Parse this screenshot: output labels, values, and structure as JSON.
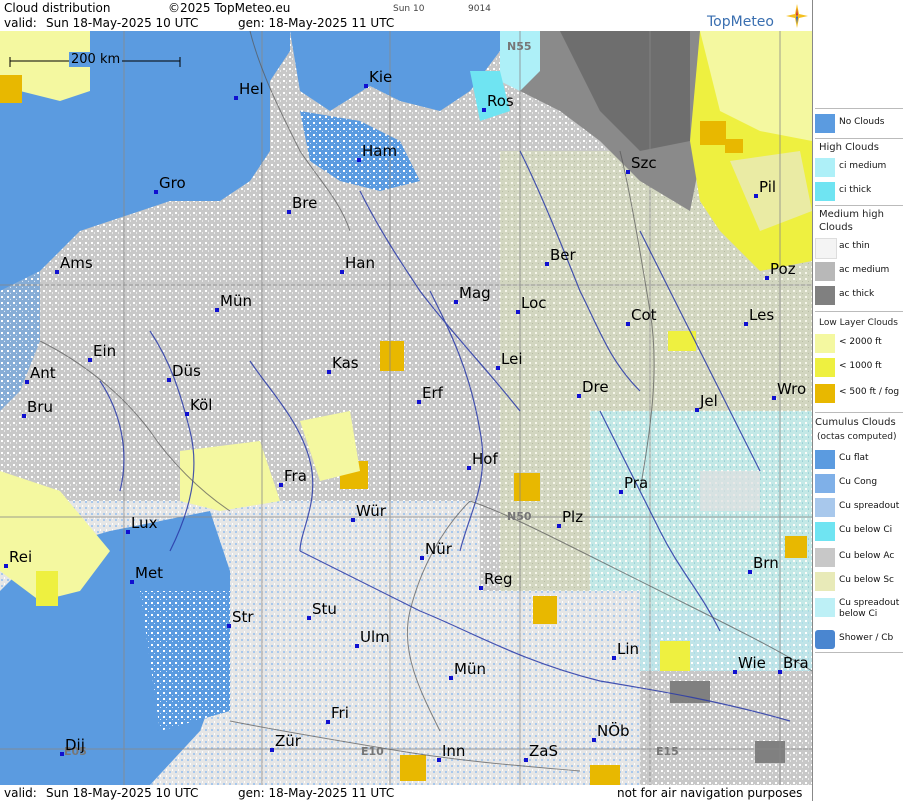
{
  "header": {
    "title": "Cloud distribution",
    "copyright": "©2025 TopMeteo.eu",
    "run_label": "Sun 10",
    "code": "9014",
    "valid_label": "valid:",
    "valid_value": "Sun  18-May-2025  10 UTC",
    "gen_value": "gen: 18-May-2025 11 UTC",
    "logo": "TopMeteo"
  },
  "footer": {
    "valid_label": "valid:",
    "valid_value": "Sun  18-May-2025  10 UTC",
    "gen_value": "gen: 18-May-2025 11 UTC",
    "disclaimer": "not for air navigation purposes"
  },
  "map": {
    "scale_label": "200 km",
    "grid_labels": [
      {
        "text": "N55"
      },
      {
        "text": "N50"
      },
      {
        "text": "E05"
      },
      {
        "text": "E10"
      },
      {
        "text": "E15"
      }
    ],
    "cities": [
      {
        "name": "Hel"
      },
      {
        "name": "Kie"
      },
      {
        "name": "Ros"
      },
      {
        "name": "Ham"
      },
      {
        "name": "Szc"
      },
      {
        "name": "Gro"
      },
      {
        "name": "Bre"
      },
      {
        "name": "Pil"
      },
      {
        "name": "Ber"
      },
      {
        "name": "Ams"
      },
      {
        "name": "Han"
      },
      {
        "name": "Poz"
      },
      {
        "name": "Mag"
      },
      {
        "name": "Loc"
      },
      {
        "name": "Mün"
      },
      {
        "name": "Cot"
      },
      {
        "name": "Les"
      },
      {
        "name": "Ein"
      },
      {
        "name": "Kas"
      },
      {
        "name": "Lei"
      },
      {
        "name": "Ant"
      },
      {
        "name": "Düs"
      },
      {
        "name": "Wro"
      },
      {
        "name": "Erf"
      },
      {
        "name": "Dre"
      },
      {
        "name": "Bru"
      },
      {
        "name": "Köl"
      },
      {
        "name": "Jel"
      },
      {
        "name": "Hof"
      },
      {
        "name": "Fra"
      },
      {
        "name": "Pra"
      },
      {
        "name": "Wür"
      },
      {
        "name": "Plz"
      },
      {
        "name": "Lux"
      },
      {
        "name": "Nür"
      },
      {
        "name": "Rei"
      },
      {
        "name": "Met"
      },
      {
        "name": "Reg"
      },
      {
        "name": "Brn"
      },
      {
        "name": "Stu"
      },
      {
        "name": "Str"
      },
      {
        "name": "Ulm"
      },
      {
        "name": "Lin"
      },
      {
        "name": "Wie"
      },
      {
        "name": "Bra"
      },
      {
        "name": "Mün"
      },
      {
        "name": "Fri"
      },
      {
        "name": "NÖb"
      },
      {
        "name": "Dij"
      },
      {
        "name": "Zür"
      },
      {
        "name": "Inn"
      },
      {
        "name": "ZaS"
      }
    ]
  },
  "legend": {
    "no_clouds": "No Clouds",
    "high_header": "High Clouds",
    "ci_medium": "ci medium",
    "ci_thick": "ci thick",
    "medium_header_1": "Medium high",
    "medium_header_2": "Clouds",
    "ac_thin": "ac thin",
    "ac_medium": "ac medium",
    "ac_thick": "ac thick",
    "low_header": "Low Layer Clouds",
    "low_2000": "< 2000 ft",
    "low_1000": "< 1000 ft",
    "low_500": "< 500 ft / fog",
    "cumulus_header": "Cumulus Clouds",
    "cumulus_sub": "(octas computed)",
    "cu_flat": "Cu flat",
    "cu_cong": "Cu Cong",
    "cu_spreadout": "Cu spreadout",
    "cu_below_ci": "Cu below Ci",
    "cu_below_ac": "Cu below Ac",
    "cu_below_sc": "Cu below Sc",
    "cu_spread_below_ci_1": "Cu spreadout",
    "cu_spread_below_ci_2": "below Ci",
    "shower": "Shower / Cb",
    "colors": {
      "no_clouds": "#5b9be0",
      "ci_medium": "#aef0f8",
      "ci_thick": "#6fe4f2",
      "ac_thin": "#f4f4f4",
      "ac_medium": "#b8b8b8",
      "ac_thick": "#808080",
      "low_2000": "#f4f8a0",
      "low_1000": "#eef040",
      "low_500": "#e8b800"
    }
  }
}
